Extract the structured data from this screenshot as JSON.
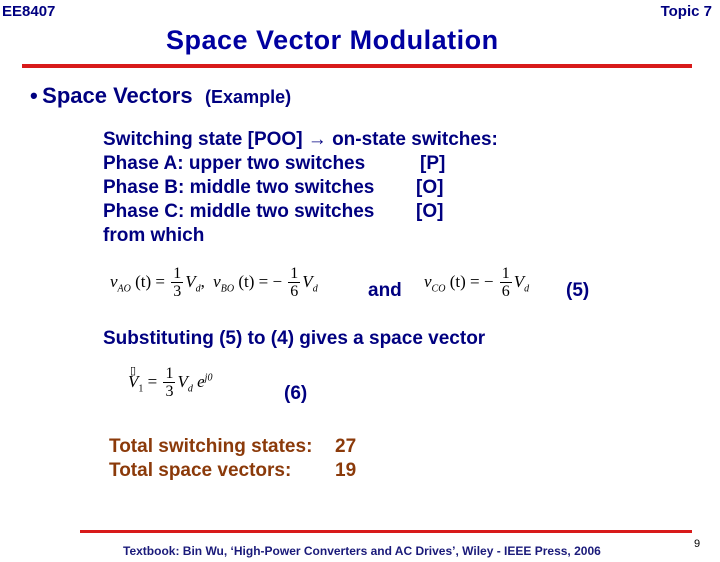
{
  "header": {
    "course": "EE8407",
    "topic": "Topic 7",
    "title": "Space Vector Modulation"
  },
  "section": {
    "bullet": "•",
    "heading": "Space Vectors",
    "subheading": "(Example)"
  },
  "lines": [
    "Switching state [POO] → on-state switches:",
    "Phase A:  upper two switches",
    "Phase B:  middle two switches",
    "Phase C:  middle two switches",
    "from which"
  ],
  "states": [
    "[P]",
    "[O]",
    "[O]"
  ],
  "eq5": {
    "vao_lhs": "v",
    "vao_sub": "AO",
    "t": "(t) =",
    "vao_num": "1",
    "vao_den": "3",
    "vd": "V",
    "vd_sub": "d",
    "vbo_lhs": "v",
    "vbo_sub": "BO",
    "vbo_sign": "−",
    "vbo_num": "1",
    "vbo_den": "6",
    "and": "and",
    "vco_lhs": "v",
    "vco_sub": "CO",
    "vco_sign": "−",
    "vco_num": "1",
    "vco_den": "6",
    "label": "(5)"
  },
  "substituting": "Substituting (5) to (4) gives a space vector",
  "eq6": {
    "v": "V",
    "v_sub": "1",
    "eq": "=",
    "num": "1",
    "den": "3",
    "vd": "V",
    "vd_sub": "d",
    "e": "e",
    "exp": "j0",
    "arrow": "▯",
    "label": "(6)"
  },
  "totals": [
    {
      "label": "Total switching states:",
      "value": "27"
    },
    {
      "label": "Total space vectors:",
      "value": "19"
    }
  ],
  "footer": {
    "citation": "Textbook: Bin Wu, ‘High-Power Converters and AC Drives’, Wiley - IEEE Press, 2006",
    "page": "9"
  }
}
